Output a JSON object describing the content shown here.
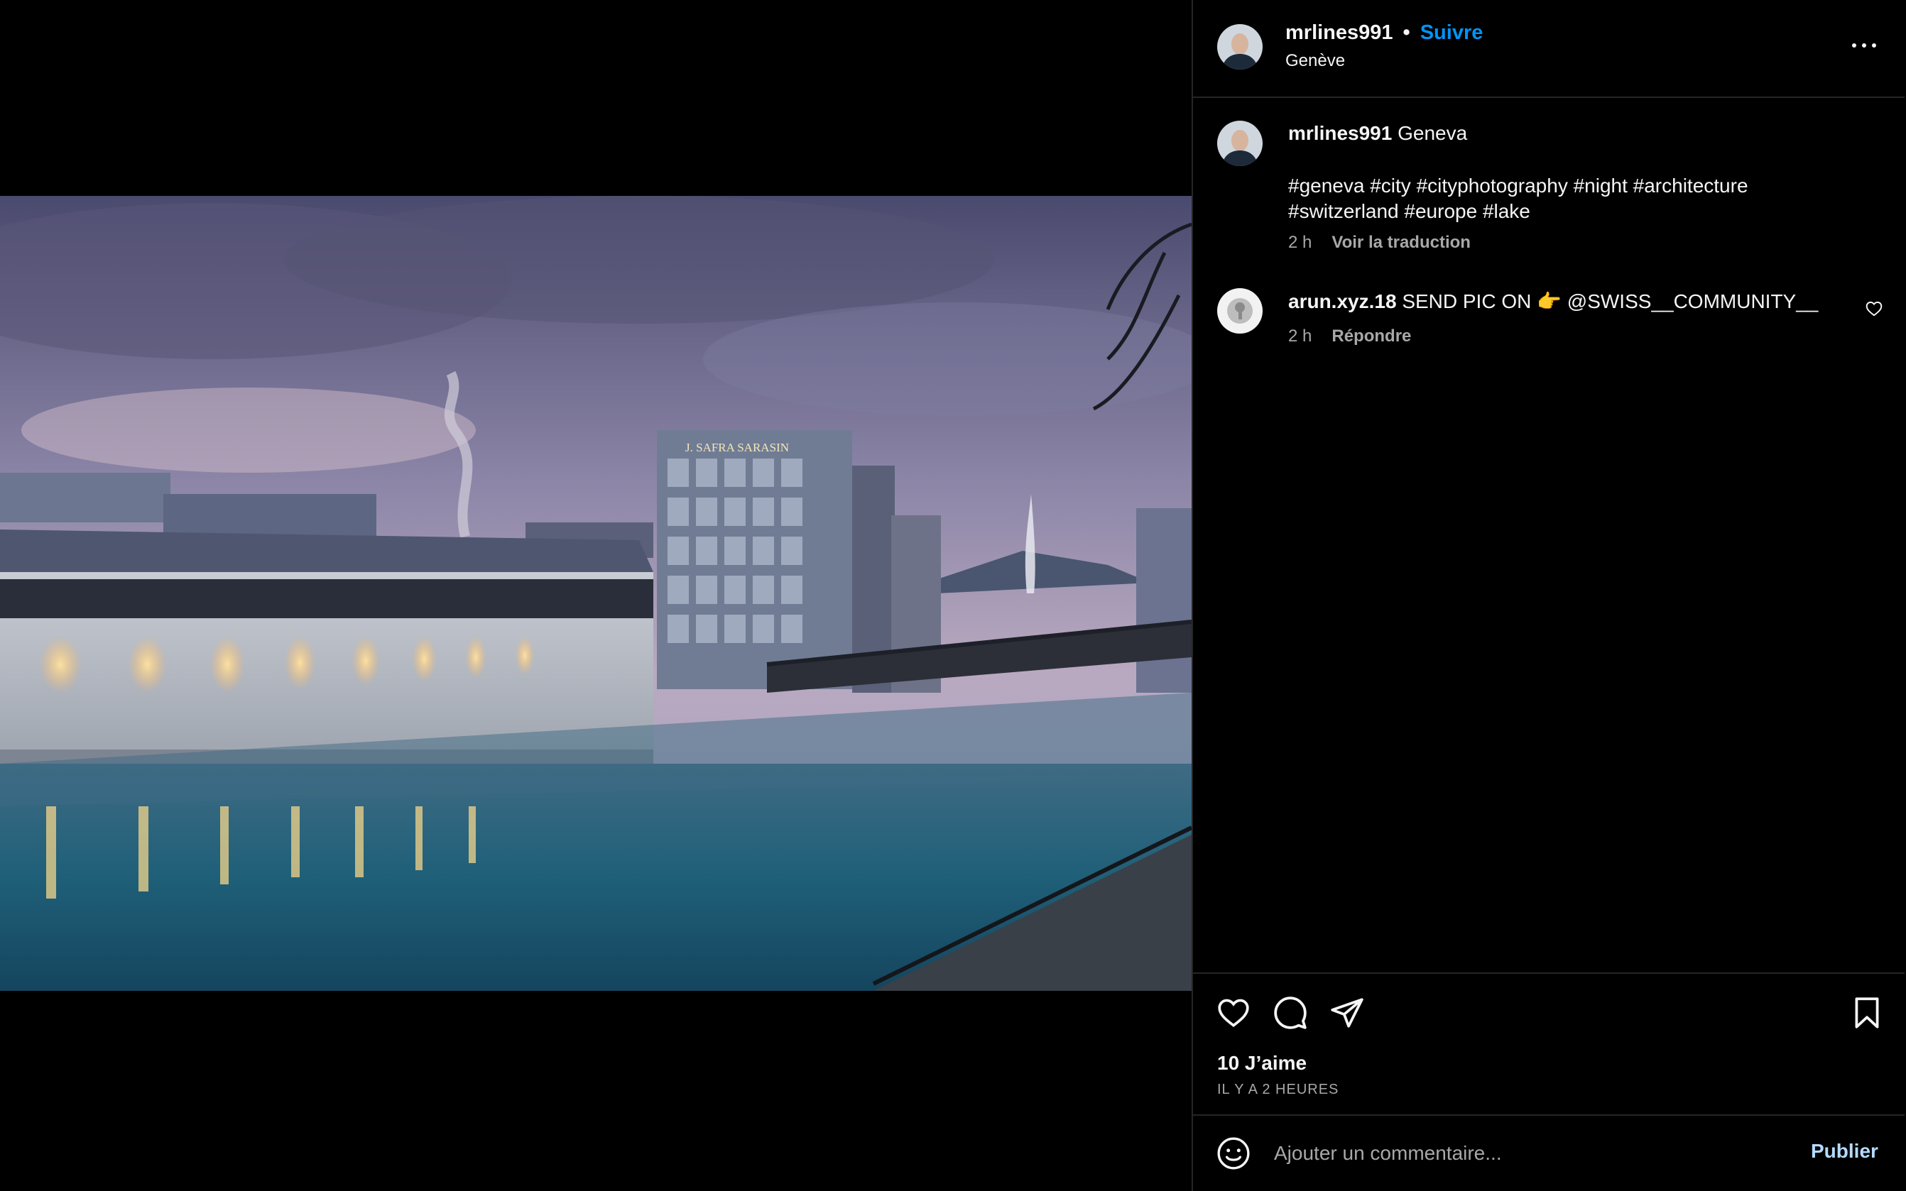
{
  "post": {
    "username": "mrlines991",
    "separator": "•",
    "follow_label": "Suivre",
    "location": "Genève",
    "photo_sign": "J. SAFRA SARASIN"
  },
  "caption": {
    "username": "mrlines991",
    "text": "Geneva",
    "hashtags": "#geneva #city #cityphotography #night #architecture #switzerland #europe #lake",
    "time": "2 h",
    "translate_label": "Voir la traduction"
  },
  "comments": [
    {
      "username": "arun.xyz.18",
      "text_prefix": "SEND PIC ON",
      "emoji": "👉",
      "text_suffix": "@SWISS__COMMUNITY__",
      "time": "2 h",
      "reply_label": "Répondre"
    }
  ],
  "actions": {
    "icons": [
      "heart-icon",
      "comment-icon",
      "share-icon",
      "bookmark-icon"
    ]
  },
  "likes": {
    "label": "10 J’aime"
  },
  "timestamp": "IL Y A 2 HEURES",
  "comment_input": {
    "placeholder": "Ajouter un commentaire...",
    "publish_label": "Publier"
  },
  "colors": {
    "follow": "#0095f6",
    "secondary_text": "#a8a8a8",
    "divider": "#262626",
    "publish": "#b3dbff"
  }
}
